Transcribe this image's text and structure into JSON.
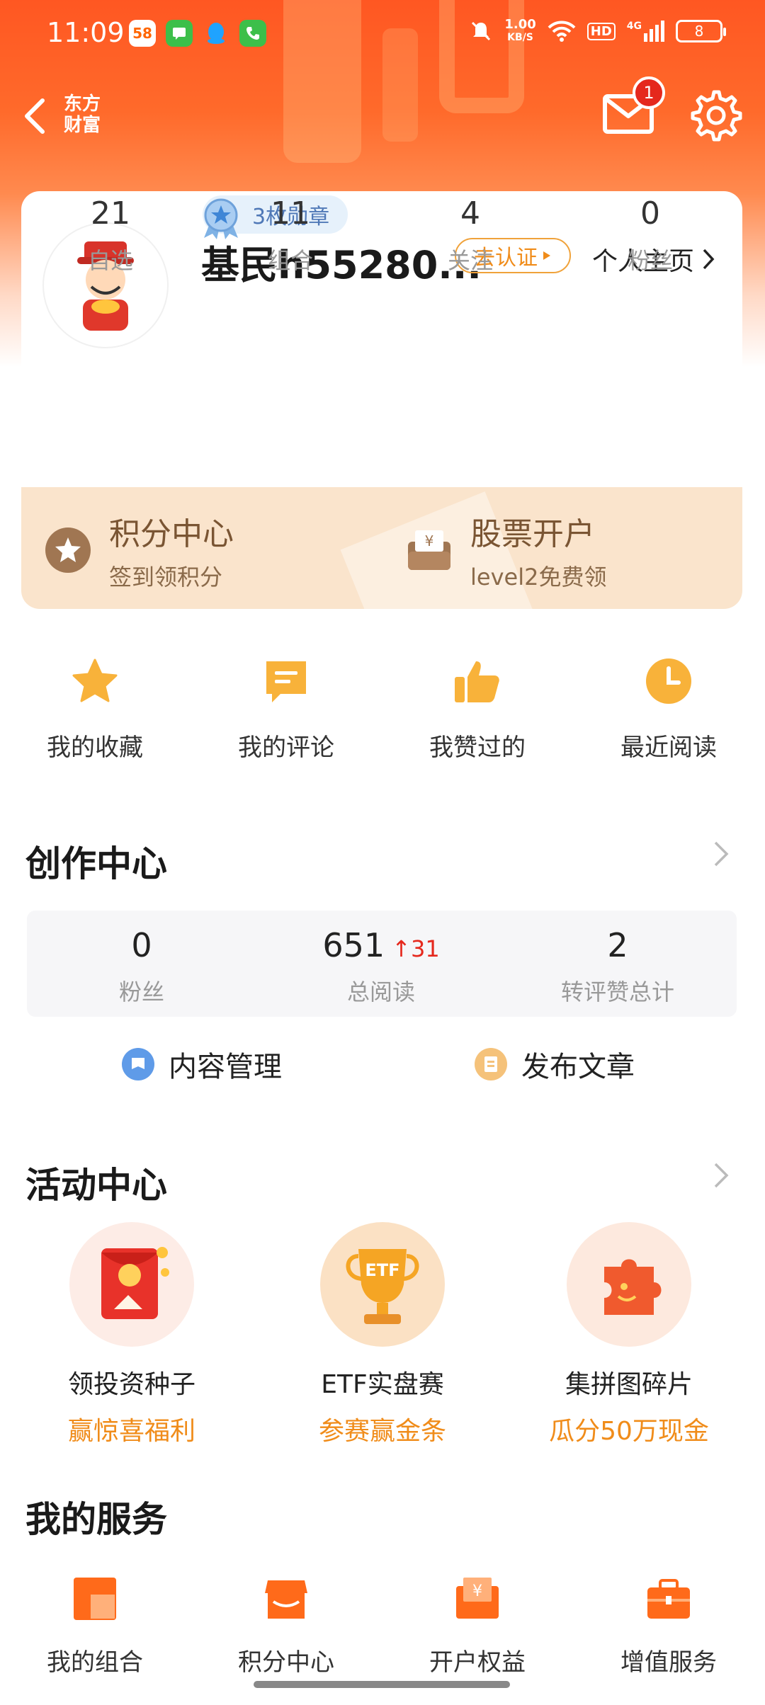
{
  "status_bar": {
    "time": "11:09",
    "apps": [
      "58",
      "msg",
      "qq",
      "phone"
    ],
    "speed_value": "1.00",
    "speed_unit": "KB/S",
    "network": "4G",
    "hd": "HD",
    "battery": "8"
  },
  "header": {
    "brand_line1": "东方",
    "brand_line2": "财富",
    "mail_badge": "1"
  },
  "profile": {
    "username": "基民h55280...",
    "verify_label": "去认证",
    "homepage_label": "个人主页",
    "medals_label": "3枚勋章",
    "stats": [
      {
        "value": "21",
        "label": "自选"
      },
      {
        "value": "11",
        "label": "组合"
      },
      {
        "value": "4",
        "label": "关注"
      },
      {
        "value": "0",
        "label": "粉丝"
      }
    ]
  },
  "promo": {
    "points": {
      "title": "积分中心",
      "sub": "签到领积分"
    },
    "account": {
      "title": "股票开户",
      "sub": "level2免费领"
    }
  },
  "quick_actions": [
    {
      "label": "我的收藏",
      "icon": "star-icon"
    },
    {
      "label": "我的评论",
      "icon": "comment-icon"
    },
    {
      "label": "我赞过的",
      "icon": "thumbs-up-icon"
    },
    {
      "label": "最近阅读",
      "icon": "clock-icon"
    }
  ],
  "creator": {
    "title": "创作中心",
    "stats": [
      {
        "value": "0",
        "label": "粉丝"
      },
      {
        "value": "651",
        "label": "总阅读",
        "delta": "31"
      },
      {
        "value": "2",
        "label": "转评赞总计"
      }
    ],
    "actions": [
      {
        "label": "内容管理"
      },
      {
        "label": "发布文章"
      }
    ]
  },
  "activities": {
    "title": "活动中心",
    "items": [
      {
        "name": "领投资种子",
        "sub": "赢惊喜福利"
      },
      {
        "name": "ETF实盘赛",
        "sub": "参赛赢金条",
        "badge": "ETF"
      },
      {
        "name": "集拼图碎片",
        "sub": "瓜分50万现金"
      }
    ]
  },
  "services": {
    "title": "我的服务",
    "items": [
      {
        "label": "我的组合"
      },
      {
        "label": "积分中心"
      },
      {
        "label": "开户权益"
      },
      {
        "label": "增值服务"
      }
    ]
  },
  "colors": {
    "brand_orange": "#ff5722",
    "accent_orange": "#f08c1a",
    "badge_red": "#e5281d",
    "promo_bg": "#fae4cc"
  }
}
